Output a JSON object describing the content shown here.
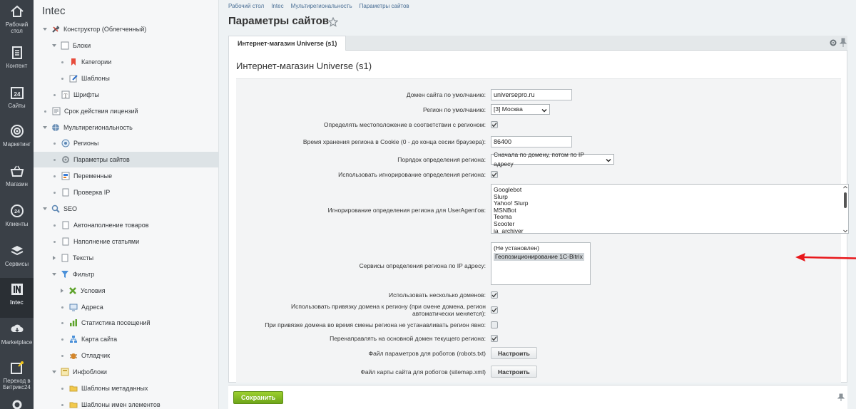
{
  "rail": {
    "items": [
      {
        "label": "Рабочий стол",
        "icon": "home-icon"
      },
      {
        "label": "Контент",
        "icon": "document-icon"
      },
      {
        "label": "Сайты",
        "icon": "calendar-icon",
        "badge": "24"
      },
      {
        "label": "Маркетинг",
        "icon": "target-icon"
      },
      {
        "label": "Магазин",
        "icon": "basket-icon"
      },
      {
        "label": "Клиенты",
        "icon": "clients-icon",
        "badge": "24"
      },
      {
        "label": "Сервисы",
        "icon": "layers-icon"
      },
      {
        "label": "Intec",
        "icon": "intec-logo-icon"
      },
      {
        "label": "Marketplace",
        "icon": "cloud-download-icon"
      },
      {
        "label": "Переход в Битрикс24",
        "icon": "bitrix24-icon"
      }
    ]
  },
  "tree": {
    "title": "Intec",
    "items": [
      {
        "label": "Конструктор (Облегченный)",
        "level": 0,
        "expanded": true
      },
      {
        "label": "Блоки",
        "level": 1,
        "expanded": true
      },
      {
        "label": "Категории",
        "level": 2
      },
      {
        "label": "Шаблоны",
        "level": 2
      },
      {
        "label": "Шрифты",
        "level": 1
      },
      {
        "label": "Срок действия лицензий",
        "level": 0
      },
      {
        "label": "Мультирегиональность",
        "level": 0,
        "expanded": true
      },
      {
        "label": "Регионы",
        "level": 1
      },
      {
        "label": "Параметры сайтов",
        "level": 1,
        "selected": true
      },
      {
        "label": "Переменные",
        "level": 1
      },
      {
        "label": "Проверка IP",
        "level": 1
      },
      {
        "label": "SEO",
        "level": 0,
        "expanded": true
      },
      {
        "label": "Автонаполнение товаров",
        "level": 1
      },
      {
        "label": "Наполнение статьями",
        "level": 1
      },
      {
        "label": "Тексты",
        "level": 1,
        "collapsed": true
      },
      {
        "label": "Фильтр",
        "level": 1,
        "expanded": true
      },
      {
        "label": "Условия",
        "level": 2,
        "collapsed": true
      },
      {
        "label": "Адреса",
        "level": 2
      },
      {
        "label": "Статистика посещений",
        "level": 2
      },
      {
        "label": "Карта сайта",
        "level": 2
      },
      {
        "label": "Отладчик",
        "level": 2
      },
      {
        "label": "Инфоблоки",
        "level": 1,
        "expanded": true
      },
      {
        "label": "Шаблоны метаданных",
        "level": 2
      },
      {
        "label": "Шаблоны имен элементов",
        "level": 2
      }
    ]
  },
  "breadcrumb": [
    "Рабочий стол",
    "Intec",
    "Мультирегиональность",
    "Параметры сайтов"
  ],
  "page_title": "Параметры сайтов",
  "tab_label": "Интернет-магазин Universe (s1)",
  "card_title": "Интернет-магазин Universe (s1)",
  "form": {
    "domain_label": "Домен сайта по умолчанию:",
    "domain_value": "universepro.ru",
    "region_label": "Регион по умолчанию:",
    "region_value": "[3] Москва",
    "detect_label": "Определять местоположение в соответствии с регионом:",
    "cookie_label": "Время хранения региона в Cookie (0 - до конца сесии браузера):",
    "cookie_value": "86400",
    "order_label": "Порядок определения региона:",
    "order_value": "Сначала по домену, потом по IP адресу",
    "ignore_use_label": "Использовать игнорирование определения региона:",
    "ignore_ua_label": "Игнорирование определения региона для UserAgent'ов:",
    "user_agents": [
      "Googlebot",
      "Slurp",
      "Yahoo! Slurp",
      "MSNBot",
      "Teoma",
      "Scooter",
      "ia_archiver"
    ],
    "ip_services_label": "Сервисы определения региона по IP адресу:",
    "ip_services": [
      "(Не установлен)",
      "Геопозиционирование 1С-Bitrix"
    ],
    "multi_domains_label": "Использовать несколько доменов:",
    "domain_binding_label": "Использовать привязку домена к региону (при смене домена, регион автоматически меняется):",
    "no_set_region_label": "При привязке домена во время смены региона не устанавливать регион явно:",
    "redirect_label": "Перенаправлять на основной домен текущего региона:",
    "robots_label": "Файл параметров для роботов (robots.txt)",
    "sitemap_label": "Файл карты сайта для роботов (sitemap.xml)",
    "configure_label": "Настроить"
  },
  "footer": {
    "save_label": "Сохранить"
  },
  "colors": {
    "accent": "#7cb51f",
    "arrow": "#e8161a",
    "rail": "#3a4047",
    "link": "#4a6f95"
  }
}
